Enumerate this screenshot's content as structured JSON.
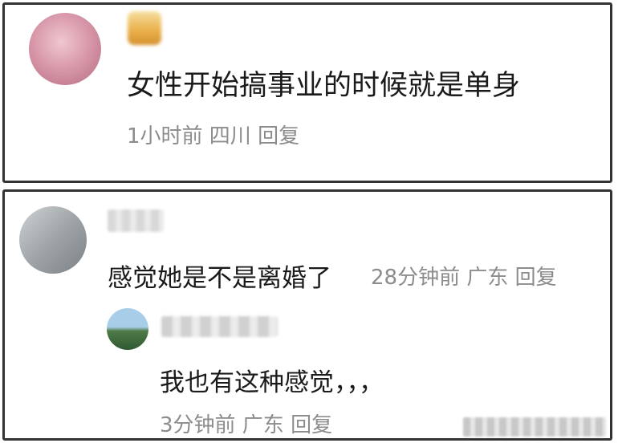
{
  "comments": [
    {
      "content": "女性开始搞事业的时候就是单身",
      "meta": "1小时前 四川 回复"
    },
    {
      "content": "感觉她是不是离婚了",
      "meta": "28分钟前 广东 回复",
      "reply": {
        "content": "我也有这种感觉，，，",
        "meta": "3分钟前 广东 回复"
      }
    }
  ]
}
